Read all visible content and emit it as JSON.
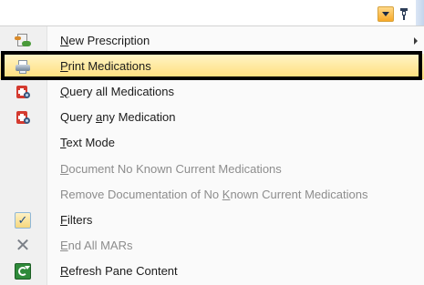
{
  "menu": {
    "items": [
      {
        "label_pre": "",
        "label_key": "N",
        "label_post": "ew Prescription",
        "icon": "prescription-icon",
        "disabled": false,
        "submenu": true
      },
      {
        "label_pre": "",
        "label_key": "P",
        "label_post": "rint Medications",
        "icon": "printer-icon",
        "disabled": false,
        "highlighted": true
      },
      {
        "label_pre": "",
        "label_key": "Q",
        "label_post": "uery all Medications",
        "icon": "query-medication-icon",
        "disabled": false
      },
      {
        "label_pre": "Query ",
        "label_key": "a",
        "label_post": "ny Medication",
        "icon": "query-medication-icon",
        "disabled": false
      },
      {
        "label_pre": "",
        "label_key": "T",
        "label_post": "ext Mode",
        "icon": "",
        "disabled": false
      },
      {
        "label_pre": "",
        "label_key": "D",
        "label_post": "ocument No Known Current Medications",
        "icon": "",
        "disabled": true
      },
      {
        "label_pre": "Remove Documentation of No ",
        "label_key": "K",
        "label_post": "nown Current Medications",
        "icon": "",
        "disabled": true
      },
      {
        "label_pre": "",
        "label_key": "F",
        "label_post": "ilters",
        "icon": "checkmark-icon",
        "disabled": false,
        "checked": true
      },
      {
        "label_pre": "",
        "label_key": "E",
        "label_post": "nd All MARs",
        "icon": "end-x-icon",
        "disabled": true
      },
      {
        "label_pre": "",
        "label_key": "R",
        "label_post": "efresh Pane Content",
        "icon": "refresh-icon",
        "disabled": false
      }
    ]
  },
  "header": {
    "dropdown_icon": "chevron-down-icon",
    "pin_icon": "pin-icon"
  },
  "colors": {
    "highlight_top": "#fff5c8",
    "highlight_bottom": "#ffdd78",
    "frame": "#000000",
    "disabled_text": "#8d8d8d"
  }
}
